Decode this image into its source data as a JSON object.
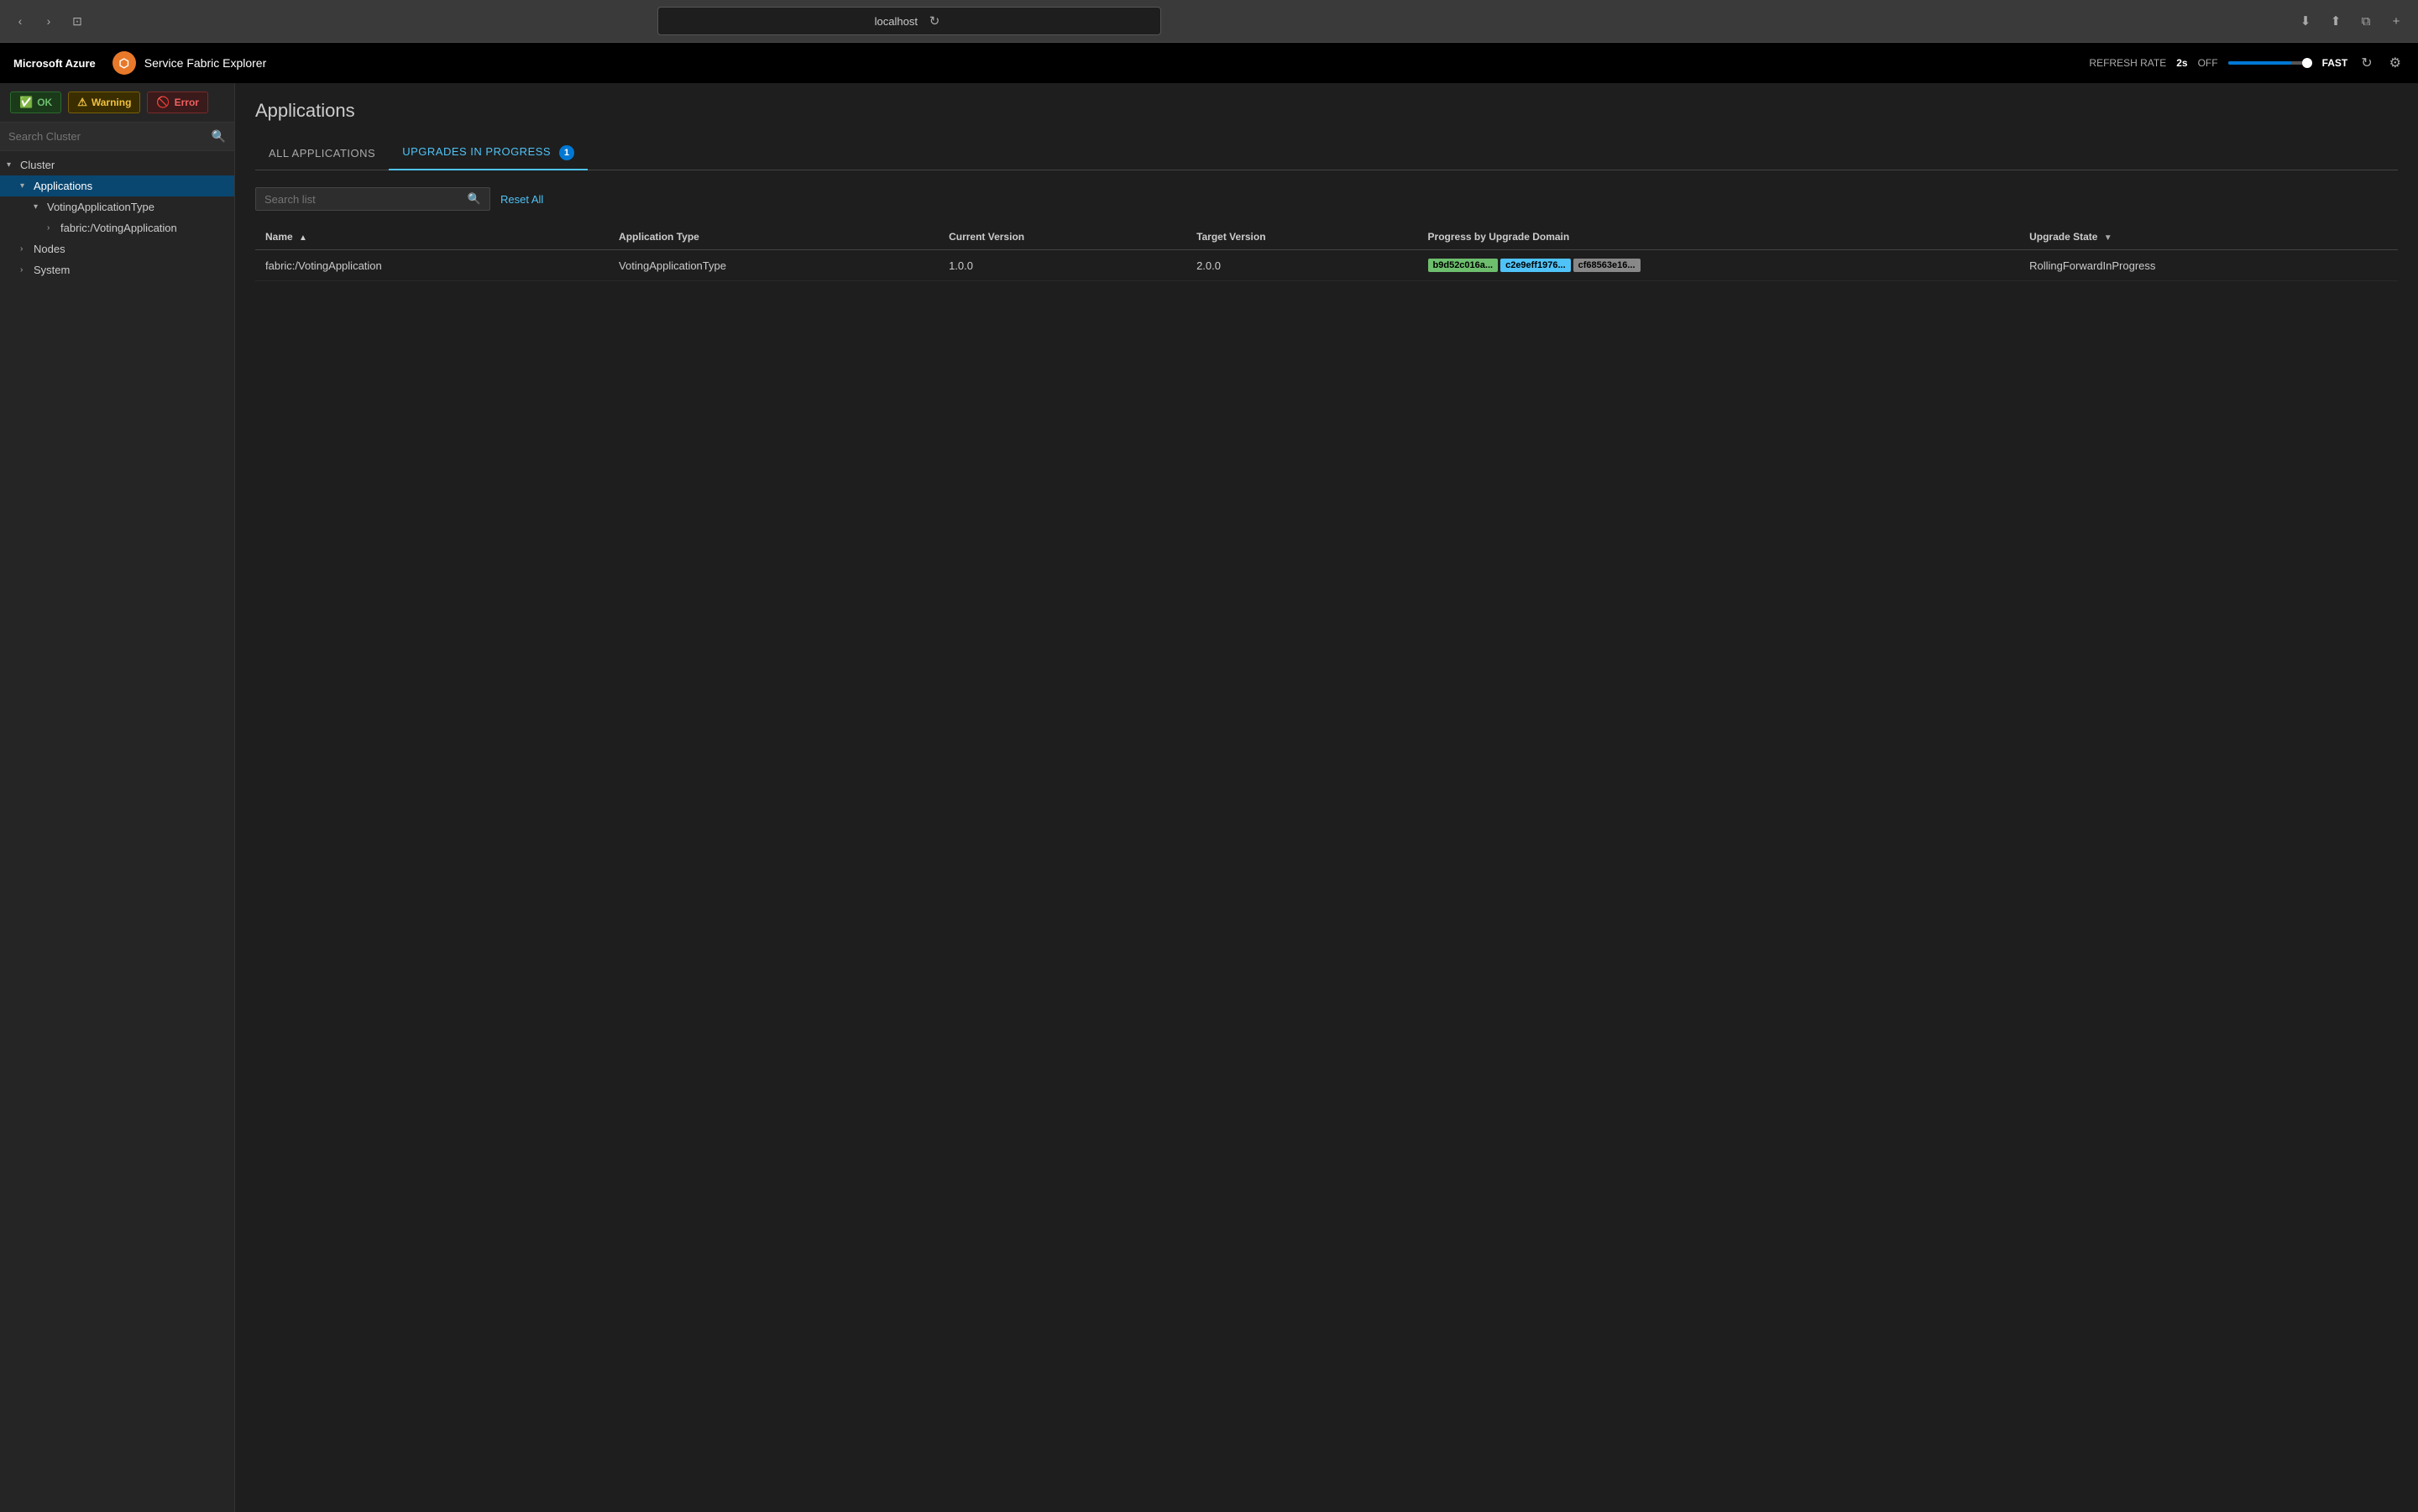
{
  "browser": {
    "url": "localhost",
    "nav_back": "‹",
    "nav_forward": "›",
    "nav_window": "⊡",
    "refresh_icon": "↻",
    "download_icon": "⬇",
    "share_icon": "⬆",
    "tabs_icon": "⧉",
    "plus_icon": "+"
  },
  "topnav": {
    "azure_label": "Microsoft Azure",
    "app_title": "Service Fabric Explorer",
    "refresh_rate_label": "REFRESH RATE",
    "refresh_rate_value": "2s",
    "refresh_toggle": "OFF",
    "speed_label": "FAST",
    "refresh_icon": "↻",
    "settings_icon": "⚙"
  },
  "sidebar": {
    "status_ok_label": "OK",
    "status_warning_label": "Warning",
    "status_error_label": "Error",
    "search_placeholder": "Search Cluster",
    "tree": [
      {
        "level": 0,
        "label": "Cluster",
        "chevron": "▾",
        "expanded": true,
        "active": false
      },
      {
        "level": 1,
        "label": "Applications",
        "chevron": "▾",
        "expanded": true,
        "active": true
      },
      {
        "level": 2,
        "label": "VotingApplicationType",
        "chevron": "▾",
        "expanded": true,
        "active": false
      },
      {
        "level": 3,
        "label": "fabric:/VotingApplication",
        "chevron": "›",
        "expanded": false,
        "active": false
      },
      {
        "level": 1,
        "label": "Nodes",
        "chevron": "›",
        "expanded": false,
        "active": false
      },
      {
        "level": 1,
        "label": "System",
        "chevron": "›",
        "expanded": false,
        "active": false
      }
    ]
  },
  "main": {
    "page_title": "Applications",
    "tabs": [
      {
        "id": "all",
        "label": "ALL APPLICATIONS",
        "active": false,
        "badge": null
      },
      {
        "id": "upgrades",
        "label": "UPGRADES IN PROGRESS",
        "active": true,
        "badge": "1"
      }
    ],
    "search_placeholder": "Search list",
    "reset_all_label": "Reset All",
    "table": {
      "columns": [
        {
          "id": "name",
          "label": "Name",
          "sort": "▲",
          "filter": null
        },
        {
          "id": "app_type",
          "label": "Application Type",
          "sort": null,
          "filter": null
        },
        {
          "id": "current_version",
          "label": "Current Version",
          "sort": null,
          "filter": null
        },
        {
          "id": "target_version",
          "label": "Target Version",
          "sort": null,
          "filter": null
        },
        {
          "id": "progress",
          "label": "Progress by Upgrade Domain",
          "sort": null,
          "filter": null
        },
        {
          "id": "upgrade_state",
          "label": "Upgrade State",
          "sort": null,
          "filter": "▼"
        }
      ],
      "rows": [
        {
          "name": "fabric:/VotingApplication",
          "app_type": "VotingApplicationType",
          "current_version": "1.0.0",
          "target_version": "2.0.0",
          "domains": [
            {
              "label": "b9d52c016a...",
              "status": "completed"
            },
            {
              "label": "c2e9eff1976...",
              "status": "in-progress"
            },
            {
              "label": "cf68563e16...",
              "status": "pending"
            }
          ],
          "upgrade_state": "RollingForwardInProgress"
        }
      ]
    }
  }
}
